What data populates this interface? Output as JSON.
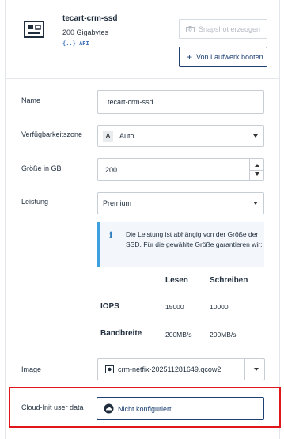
{
  "disk": {
    "name": "tecart-crm-ssd",
    "size": "200 Gigabytes",
    "api_label": "{..} API"
  },
  "actions": {
    "snapshot_label": "Snapshot erzeugen",
    "boot_label": "Von Laufwerk booten"
  },
  "form": {
    "name_label": "Name",
    "name_value": "tecart-crm-ssd",
    "az_label": "Verfügbarkeitszone",
    "az_badge": "A",
    "az_value": "Auto",
    "size_label": "Größe in GB",
    "size_value": "200",
    "performance_label": "Leistung",
    "performance_value": "Premium",
    "info_icon": "i",
    "info_text": "Die Leistung ist abhängig von der Größe der SSD. Für die gewählte Größe garantieren wir:",
    "image_label": "Image",
    "image_value": "crm-netfix-202511281649.qcow2",
    "cloud_init_label": "Cloud-Init user data",
    "cloud_init_value": "Nicht konfiguriert"
  },
  "perf_table": {
    "headers": [
      "Lesen",
      "Schreiben"
    ],
    "rows": [
      {
        "label": "IOPS",
        "read": "15000",
        "write": "10000"
      },
      {
        "label": "Bandbreite",
        "read": "200MB/s",
        "write": "200MB/s"
      }
    ]
  },
  "icons": {
    "drive": "drive-icon",
    "snapshot": "camera-icon",
    "boot": "plus-icon",
    "image": "image-icon",
    "cloud_init": "cloud-init-icon"
  },
  "colors": {
    "primary": "#1d3f72",
    "info_accent": "#3ea0dd",
    "highlight": "#e0171a"
  }
}
